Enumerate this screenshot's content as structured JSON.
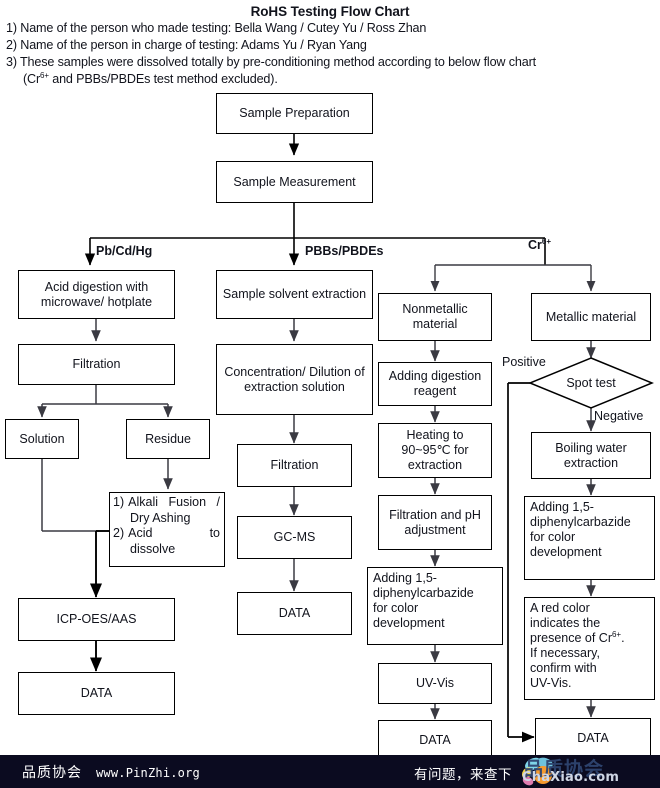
{
  "header": {
    "title": "RoHS Testing Flow Chart",
    "notes": [
      "1) Name of the person who made testing: Bella Wang / Cutey Yu / Ross Zhan",
      "2) Name of the person in charge of testing: Adams Yu / Ryan Yang",
      "3) These samples were dissolved totally by pre-conditioning method according to below flow chart"
    ],
    "note3_cont_pre": "(Cr",
    "note3_cont_sup": "6+",
    "note3_cont_post": " and PBBs/PBDEs test method excluded)."
  },
  "branch_labels": {
    "metals": "Pb/Cd/Hg",
    "pbbs": "PBBs/PBDEs",
    "chrome_pre": "Cr",
    "chrome_sup": "6+"
  },
  "edge_labels": {
    "positive": "Positive",
    "negative": "Negative"
  },
  "nodes": {
    "sample_preparation": "Sample Preparation",
    "sample_measurement": "Sample Measurement",
    "acid_digestion": "Acid digestion with microwave/ hotplate",
    "filtration_left": "Filtration",
    "solution": "Solution",
    "residue": "Residue",
    "alkali_num1": "1)",
    "alkali_txt1": "Alkali Fusion /",
    "alkali_cont1": "Dry Ashing",
    "alkali_num2": "2)",
    "alkali_txt2": "Acid to",
    "alkali_cont2": "dissolve",
    "icp_oes_aas": "ICP-OES/AAS",
    "data_left": "DATA",
    "sample_solvent_extraction": "Sample solvent extraction",
    "concentration_dilution": "Concentration/ Dilution of extraction solution",
    "filtration_mid": "Filtration",
    "gc_ms": "GC-MS",
    "data_mid": "DATA",
    "nonmetallic_material": "Nonmetallic material",
    "adding_digestion_reagent": "Adding digestion reagent",
    "heating_line1": "Heating to",
    "heating_line2": "90~95℃  for",
    "heating_line3": "extraction",
    "filtration_ph": "Filtration and pH adjustment",
    "adding_dpc_left_l1": "Adding                 1,5-",
    "adding_dpc_left_l2": "diphenylcarbazide",
    "adding_dpc_left_l3": "for                     color",
    "adding_dpc_left_l4": "development",
    "uv_vis": "UV-Vis",
    "data_cr_left": "DATA",
    "metallic_material": "Metallic material",
    "spot_test": "Spot test",
    "boiling_water_extraction": "Boiling water extraction",
    "adding_dpc_right_l1": "Adding                1,5-",
    "adding_dpc_right_l2": "diphenylcarbazide",
    "adding_dpc_right_l3": "for                   color",
    "adding_dpc_right_l4": "development",
    "red_color_l1": "A        red        color",
    "red_color_l2": "indicates               the",
    "red_color_l3_pre": "presence   of   Cr",
    "red_color_l3_sup": "6+",
    "red_color_l3_post": ".",
    "red_color_l4": "If            necessary,",
    "red_color_l5": "confirm              with",
    "red_color_l6": "UV-Vis.",
    "data_cr_right": "DATA"
  },
  "footer": {
    "brand_cn": "品质协会",
    "url": "www.PinZhi.org",
    "right_text": "有问题，来查下",
    "watermark_cn": "品质协会",
    "watermark_en": "ChaXiao.com"
  },
  "colors": {
    "stroke": "#000000",
    "box_fill": "#ffffff",
    "text": "#11131c",
    "footer_bg": "#0b0b20",
    "page_bg": "#ffffff"
  }
}
